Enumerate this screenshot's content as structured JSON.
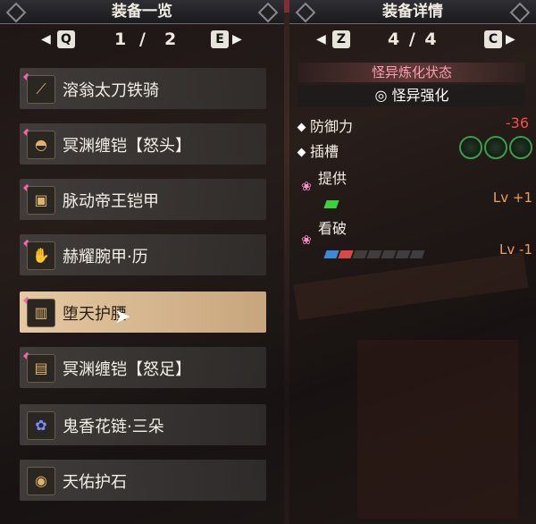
{
  "left": {
    "title": "装备一览",
    "page_current": "1",
    "page_sep": "/",
    "page_total": "2",
    "key_prev": "Q",
    "key_next": "E",
    "items": [
      {
        "name": "溶翁太刀铁骑",
        "icon": "sword-icon"
      },
      {
        "name": "冥渊缠铠【怒头】",
        "icon": "helmet-icon"
      },
      {
        "name": "脉动帝王铠甲",
        "icon": "chest-armor-icon"
      },
      {
        "name": "赫耀腕甲·历",
        "icon": "gauntlet-icon"
      },
      {
        "name": "堕天护腰",
        "icon": "waist-armor-icon",
        "selected": true
      },
      {
        "name": "冥渊缠铠【怒足】",
        "icon": "greaves-icon"
      },
      {
        "name": "鬼香花链·三朵",
        "icon": "charm-icon"
      },
      {
        "name": "天佑护石",
        "icon": "talisman-icon"
      }
    ]
  },
  "right": {
    "title": "装备详情",
    "page": "4 / 4",
    "key_prev": "Z",
    "key_next": "C",
    "section_title": "怪异炼化状态",
    "subtitle": "怪异强化",
    "defense_label": "防御力",
    "defense_value": "-36",
    "slot_label": "插槽",
    "skills": [
      {
        "name": "提供",
        "level": "Lv +1",
        "filled": 1,
        "color": "#3cd23c"
      },
      {
        "name": "看破",
        "level": "Lv -1",
        "filled": 2,
        "color": "#3a8ad8"
      }
    ]
  },
  "colors": {
    "accent_pink": "#ff9fb0",
    "negative": "#ff4a4a",
    "level": "#f0a05a"
  }
}
